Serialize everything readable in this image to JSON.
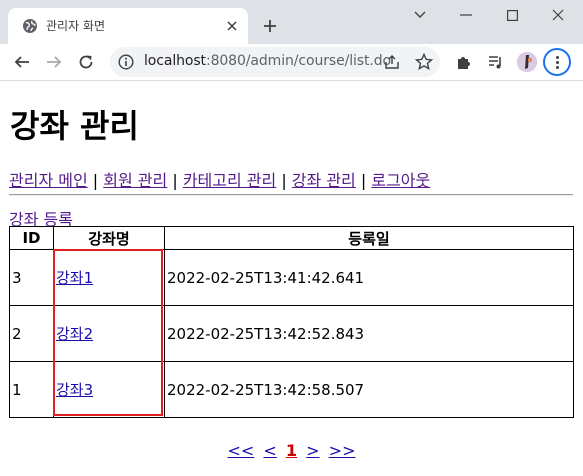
{
  "browser": {
    "tab_title": "관리자 화면",
    "url_host": "localhost",
    "url_rest": ":8080/admin/course/list.do"
  },
  "page": {
    "title": "강좌 관리",
    "nav": [
      {
        "label": "관리자 메인"
      },
      {
        "label": "회원 관리"
      },
      {
        "label": "카테고리 관리"
      },
      {
        "label": "강좌 관리"
      },
      {
        "label": "로그아웃"
      }
    ],
    "nav_separator": "|",
    "add_link": "강좌 등록",
    "table": {
      "headers": [
        "ID",
        "강좌명",
        "등록일"
      ],
      "rows": [
        {
          "id": "3",
          "name": "강좌1",
          "date": "2022-02-25T13:41:42.641"
        },
        {
          "id": "2",
          "name": "강좌2",
          "date": "2022-02-25T13:42:52.843"
        },
        {
          "id": "1",
          "name": "강좌3",
          "date": "2022-02-25T13:42:58.507"
        }
      ]
    },
    "pager": {
      "first": "<<",
      "prev": "<",
      "current": "1",
      "next": ">",
      "last": ">>"
    }
  },
  "colors": {
    "link_visited": "#551a8b",
    "link": "#1a0dab",
    "highlight": "#e02020",
    "current_page": "#cc0000"
  }
}
